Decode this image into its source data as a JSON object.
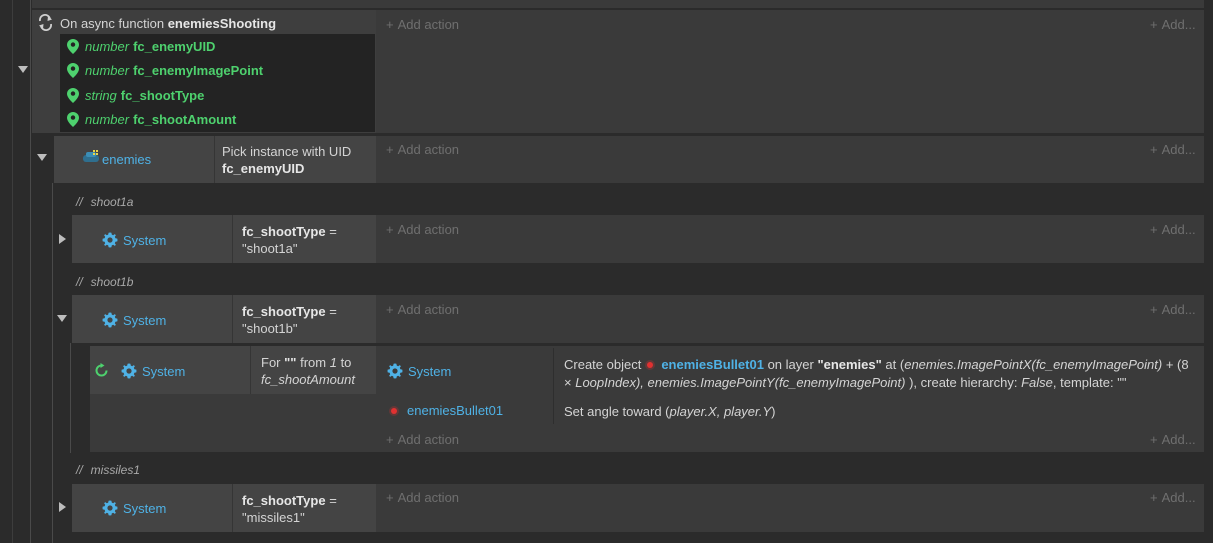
{
  "function_block": {
    "prefix": "On async function",
    "name": "enemiesShooting",
    "params": [
      {
        "type": "number",
        "name": "fc_enemyUID"
      },
      {
        "type": "number",
        "name": "fc_enemyImagePoint"
      },
      {
        "type": "string",
        "name": "fc_shootType"
      },
      {
        "type": "number",
        "name": "fc_shootAmount"
      }
    ]
  },
  "add_action_label": "Add action",
  "add_short_label": "Add...",
  "plus": "+",
  "pick_block": {
    "object": "enemies",
    "condition_line1": "Pick instance with UID",
    "condition_line2": "fc_enemyUID"
  },
  "comments": {
    "slash": "//",
    "c1": "shoot1a",
    "c2": "shoot1b",
    "c3": "missiles1"
  },
  "system_label": "System",
  "cond_shoot1a": {
    "var": "fc_shootType",
    "op": "=",
    "value": "\"shoot1a\""
  },
  "cond_shoot1b": {
    "var": "fc_shootType",
    "op": "=",
    "value": "\"shoot1b\""
  },
  "cond_missiles1": {
    "var": "fc_shootType",
    "op": "=",
    "value": "\"missiles1\""
  },
  "loop_block": {
    "cond_for": "For",
    "cond_quote": "\"\"",
    "cond_from": "from",
    "cond_start": "1",
    "cond_to": "to",
    "cond_end": "fc_shootAmount",
    "action1_object": "System",
    "action1_text_a": "Create object",
    "action1_obj": "enemiesBullet01",
    "action1_text_b": "on layer",
    "action1_layer": "\"enemies\"",
    "action1_text_c": "at (",
    "action1_expr1": "enemies.ImagePointX(fc_enemyImagePoint)",
    "action1_text_d": "+ (8 ×",
    "action1_expr2": "LoopIndex), enemies.ImagePointY(fc_enemyImagePoint)",
    "action1_text_e": "), create hierarchy:",
    "action1_false": "False",
    "action1_text_f": ", template: \"\"",
    "action2_object": "enemiesBullet01",
    "action2_text_a": "Set angle toward (",
    "action2_expr": "player.X, player.Y",
    "action2_text_b": ")"
  },
  "colors": {
    "accent_blue": "#4fb2e6",
    "param_green": "#4ed16e",
    "background": "#2b2b2b"
  },
  "icons": {
    "function": "loop-arrows-icon",
    "param": "location-pin-icon",
    "system": "gear-icon",
    "loop": "refresh-icon"
  }
}
